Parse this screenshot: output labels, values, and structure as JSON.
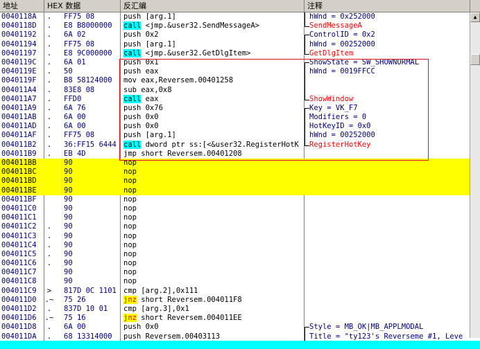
{
  "headers": {
    "addr": "地址",
    "hex": "HEX 数据",
    "dis": "反汇编",
    "cmt": "注释"
  },
  "rows": [
    {
      "addr": "0040118A",
      "mark": ".",
      "hex": "FF75 08",
      "pre": "push [arg.1]",
      "kw": "",
      "post": "",
      "cmt": "hWnd = 0x252000",
      "cmtc": "n",
      "br": "mid"
    },
    {
      "addr": "0040118D",
      "mark": ".",
      "hex": "E8 B8000000",
      "pre": "",
      "kw": "call",
      "post": " <jmp.&user32.SendMessageA>",
      "kwt": "call",
      "cmt": "SendMessageA",
      "cmtc": "r",
      "br": "end"
    },
    {
      "addr": "00401192",
      "mark": ".",
      "hex": "6A 02",
      "pre": "push 0x2",
      "kw": "",
      "post": "",
      "cmt": "ControlID = 0x2",
      "cmtc": "n",
      "br": "start"
    },
    {
      "addr": "00401194",
      "mark": ".",
      "hex": "FF75 08",
      "pre": "push [arg.1]",
      "kw": "",
      "post": "",
      "cmt": "hWnd = 00252000",
      "cmtc": "n",
      "br": "mid"
    },
    {
      "addr": "00401197",
      "mark": ".",
      "hex": "E8 9C000000",
      "pre": "",
      "kw": "call",
      "post": " <jmp.&user32.GetDlgItem>",
      "kwt": "call",
      "cmt": "GetDlgItem",
      "cmtc": "r",
      "br": "end"
    },
    {
      "addr": "0040119C",
      "mark": ".",
      "hex": "6A 01",
      "pre": "push 0x1",
      "kw": "",
      "post": "",
      "cmt": "ShowState = SW_SHOWNORMAL",
      "cmtc": "n",
      "br": "start"
    },
    {
      "addr": "0040119E",
      "mark": ".",
      "hex": "50",
      "pre": "push eax",
      "kw": "",
      "post": "",
      "cmt": "hWnd = 0019FFCC",
      "cmtc": "n",
      "br": "mid"
    },
    {
      "addr": "0040119F",
      "mark": ".",
      "hex": "B8 58124000",
      "pre": "mov eax,Reversem.00401258",
      "kw": "",
      "post": "",
      "cmt": "",
      "cmtc": "n",
      "br": "mid"
    },
    {
      "addr": "004011A4",
      "mark": ".",
      "hex": "83E8 08",
      "pre": "sub eax,0x8",
      "kw": "",
      "post": "",
      "cmt": "",
      "cmtc": "n",
      "br": "mid"
    },
    {
      "addr": "004011A7",
      "mark": ".",
      "hex": "FFD0",
      "pre": "",
      "kw": "call",
      "post": " eax",
      "kwt": "call",
      "cmt": "ShowWindow",
      "cmtc": "r",
      "br": "end"
    },
    {
      "addr": "004011A9",
      "mark": ".",
      "hex": "6A 76",
      "pre": "push 0x76",
      "kw": "",
      "post": "",
      "cmt": "Key = VK_F7",
      "cmtc": "n",
      "br": "start"
    },
    {
      "addr": "004011AB",
      "mark": ".",
      "hex": "6A 00",
      "pre": "push 0x0",
      "kw": "",
      "post": "",
      "cmt": "Modifiers = 0",
      "cmtc": "n",
      "br": "mid"
    },
    {
      "addr": "004011AD",
      "mark": ".",
      "hex": "6A 00",
      "pre": "push 0x0",
      "kw": "",
      "post": "",
      "cmt": "HotKeyID = 0x0",
      "cmtc": "n",
      "br": "mid"
    },
    {
      "addr": "004011AF",
      "mark": ".",
      "hex": "FF75 08",
      "pre": "push [arg.1]",
      "kw": "",
      "post": "",
      "cmt": "hWnd = 00252000",
      "cmtc": "n",
      "br": "mid"
    },
    {
      "addr": "004011B2",
      "mark": ".",
      "hex": "36:FF15 6444",
      "pre": "",
      "kw": "call",
      "post": " dword ptr ss:[<&user32.RegisterHotK",
      "kwt": "call",
      "cmt": "RegisterHotKey",
      "cmtc": "r",
      "br": "end"
    },
    {
      "addr": "004011B9",
      "mark": ".",
      "hex": "EB 4D",
      "pre": "jmp short Reversem.00401208",
      "kw": "",
      "post": "",
      "cmt": "",
      "cmtc": "n",
      "br": ""
    },
    {
      "addr": "004011BB",
      "mark": "",
      "hex": "90",
      "pre": "nop",
      "kw": "",
      "post": "",
      "cmt": "",
      "cmtc": "n",
      "br": "",
      "hl": true
    },
    {
      "addr": "004011BC",
      "mark": "",
      "hex": "90",
      "pre": "nop",
      "kw": "",
      "post": "",
      "cmt": "",
      "cmtc": "n",
      "br": "",
      "hl": true
    },
    {
      "addr": "004011BD",
      "mark": "",
      "hex": "90",
      "pre": "nop",
      "kw": "",
      "post": "",
      "cmt": "",
      "cmtc": "n",
      "br": "",
      "hl": true
    },
    {
      "addr": "004011BE",
      "mark": "",
      "hex": "90",
      "pre": "nop",
      "kw": "",
      "post": "",
      "cmt": "",
      "cmtc": "n",
      "br": "",
      "hl": true
    },
    {
      "addr": "004011BF",
      "mark": "",
      "hex": "90",
      "pre": "nop",
      "kw": "",
      "post": "",
      "cmt": "",
      "cmtc": "n",
      "br": ""
    },
    {
      "addr": "004011C0",
      "mark": "",
      "hex": "90",
      "pre": "nop",
      "kw": "",
      "post": "",
      "cmt": "",
      "cmtc": "n",
      "br": ""
    },
    {
      "addr": "004011C1",
      "mark": "",
      "hex": "90",
      "pre": "nop",
      "kw": "",
      "post": "",
      "cmt": "",
      "cmtc": "n",
      "br": ""
    },
    {
      "addr": "004011C2",
      "mark": ".",
      "hex": "90",
      "pre": "nop",
      "kw": "",
      "post": "",
      "cmt": "",
      "cmtc": "n",
      "br": ""
    },
    {
      "addr": "004011C3",
      "mark": ".",
      "hex": "90",
      "pre": "nop",
      "kw": "",
      "post": "",
      "cmt": "",
      "cmtc": "n",
      "br": ""
    },
    {
      "addr": "004011C4",
      "mark": ".",
      "hex": "90",
      "pre": "nop",
      "kw": "",
      "post": "",
      "cmt": "",
      "cmtc": "n",
      "br": ""
    },
    {
      "addr": "004011C5",
      "mark": ".",
      "hex": "90",
      "pre": "nop",
      "kw": "",
      "post": "",
      "cmt": "",
      "cmtc": "n",
      "br": ""
    },
    {
      "addr": "004011C6",
      "mark": ".",
      "hex": "90",
      "pre": "nop",
      "kw": "",
      "post": "",
      "cmt": "",
      "cmtc": "n",
      "br": ""
    },
    {
      "addr": "004011C7",
      "mark": "",
      "hex": "90",
      "pre": "nop",
      "kw": "",
      "post": "",
      "cmt": "",
      "cmtc": "n",
      "br": ""
    },
    {
      "addr": "004011C8",
      "mark": "",
      "hex": "90",
      "pre": "nop",
      "kw": "",
      "post": "",
      "cmt": "",
      "cmtc": "n",
      "br": ""
    },
    {
      "addr": "004011C9",
      "mark": ">",
      "hex": "817D 0C 1101",
      "pre": "cmp [arg.2],0x111",
      "kw": "",
      "post": "",
      "cmt": "",
      "cmtc": "n",
      "br": ""
    },
    {
      "addr": "004011D0",
      "mark": ".~",
      "hex": "75 26",
      "pre": "",
      "kw": "jnz",
      "post": " short Reversem.004011F8",
      "kwt": "jnz",
      "cmt": "",
      "cmtc": "n",
      "br": ""
    },
    {
      "addr": "004011D2",
      "mark": ".",
      "hex": "837D 10 01",
      "pre": "cmp [arg.3],0x1",
      "kw": "",
      "post": "",
      "cmt": "",
      "cmtc": "n",
      "br": ""
    },
    {
      "addr": "004011D6",
      "mark": ".~",
      "hex": "75 16",
      "pre": "",
      "kw": "jnz",
      "post": " short Reversem.004011EE",
      "kwt": "jnz",
      "cmt": "",
      "cmtc": "n",
      "br": ""
    },
    {
      "addr": "004011D8",
      "mark": ".",
      "hex": "6A 00",
      "pre": "push 0x0",
      "kw": "",
      "post": "",
      "cmt": "Style = MB_OK|MB_APPLMODAL",
      "cmtc": "n",
      "br": "start"
    },
    {
      "addr": "004011DA",
      "mark": ".",
      "hex": "68 13314000",
      "pre": "push Reversem.00403113",
      "kw": "",
      "post": "",
      "cmt": "Title = \"ty123's Reverseme #1, Leve",
      "cmtc": "n",
      "br": "mid"
    }
  ]
}
